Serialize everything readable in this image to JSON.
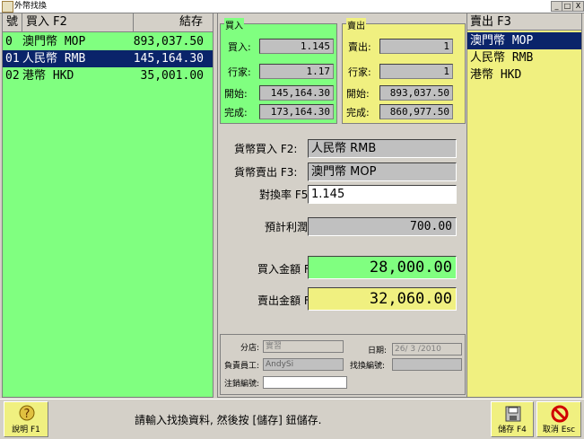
{
  "window": {
    "title": "外幣找換",
    "buttons": [
      "_",
      "□",
      "X"
    ]
  },
  "buy_list": {
    "header": {
      "no": "號",
      "name": "買入 F2",
      "stock": "結存"
    },
    "rows": [
      {
        "no": "0",
        "name": "澳門幣 MOP",
        "stock": "893,037.50",
        "selected": false
      },
      {
        "no": "01",
        "name": "人民幣 RMB",
        "stock": "145,164.30",
        "selected": true
      },
      {
        "no": "02",
        "name": "港幣 HKD",
        "stock": "35,001.00",
        "selected": false
      }
    ]
  },
  "buy_group": {
    "title": "買入",
    "rate_label": "買入:",
    "rate": "1.145",
    "quote_label": "行家:",
    "quote": "1.17",
    "start_label": "開始:",
    "start": "145,164.30",
    "end_label": "完成:",
    "end": "173,164.30"
  },
  "sell_group": {
    "title": "賣出",
    "rate_label": "賣出:",
    "rate": "1",
    "quote_label": "行家:",
    "quote": "1",
    "start_label": "開始:",
    "start": "893,037.50",
    "end_label": "完成:",
    "end": "860,977.50"
  },
  "form": {
    "buy_currency_label": "貨幣買入 F2:",
    "buy_currency": "人民幣 RMB",
    "sell_currency_label": "貨幣賣出 F3:",
    "sell_currency": "澳門幣 MOP",
    "rate_label": "對換率 F5:",
    "rate": "1.145",
    "profit_label": "預計利潤:",
    "profit": "700.00",
    "buy_amount_label": "買入金額 F6:",
    "buy_amount": "28,000.00",
    "sell_amount_label": "賣出金額 F7:",
    "sell_amount": "32,060.00"
  },
  "meta": {
    "branch_label": "分店:",
    "branch": "實習",
    "date_label": "日期:",
    "date": "26/ 3 /2010",
    "staff_label": "負責員工:",
    "staff": "AndySi",
    "exchange_no_label": "找換編號:",
    "exchange_no": "",
    "cancel_no_label": "注銷編號:",
    "cancel_no": ""
  },
  "sell_list": {
    "header": "賣出 F3",
    "rows": [
      {
        "name": "澳門幣 MOP",
        "selected": true
      },
      {
        "name": "人民幣 RMB",
        "selected": false
      },
      {
        "name": "港幣 HKD",
        "selected": false
      }
    ]
  },
  "footer": {
    "help_label": "說明 F1",
    "message": "請輸入找換資料, 然後按 [儲存] 鈕儲存.",
    "save_label": "儲存 F4",
    "cancel_label": "取消 Esc"
  },
  "colors": {
    "buy_bg": "#80ff80",
    "sell_bg": "#f0f080",
    "selected": "#0a246a"
  }
}
